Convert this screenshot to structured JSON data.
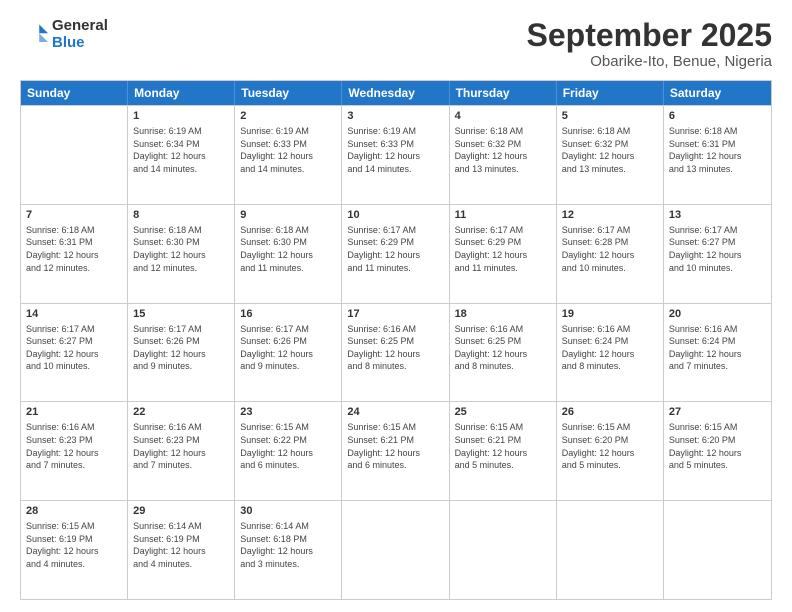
{
  "logo": {
    "general": "General",
    "blue": "Blue"
  },
  "header": {
    "month": "September 2025",
    "location": "Obarike-Ito, Benue, Nigeria"
  },
  "days": [
    "Sunday",
    "Monday",
    "Tuesday",
    "Wednesday",
    "Thursday",
    "Friday",
    "Saturday"
  ],
  "weeks": [
    [
      {
        "day": "",
        "info": ""
      },
      {
        "day": "1",
        "info": "Sunrise: 6:19 AM\nSunset: 6:34 PM\nDaylight: 12 hours\nand 14 minutes."
      },
      {
        "day": "2",
        "info": "Sunrise: 6:19 AM\nSunset: 6:33 PM\nDaylight: 12 hours\nand 14 minutes."
      },
      {
        "day": "3",
        "info": "Sunrise: 6:19 AM\nSunset: 6:33 PM\nDaylight: 12 hours\nand 14 minutes."
      },
      {
        "day": "4",
        "info": "Sunrise: 6:18 AM\nSunset: 6:32 PM\nDaylight: 12 hours\nand 13 minutes."
      },
      {
        "day": "5",
        "info": "Sunrise: 6:18 AM\nSunset: 6:32 PM\nDaylight: 12 hours\nand 13 minutes."
      },
      {
        "day": "6",
        "info": "Sunrise: 6:18 AM\nSunset: 6:31 PM\nDaylight: 12 hours\nand 13 minutes."
      }
    ],
    [
      {
        "day": "7",
        "info": "Sunrise: 6:18 AM\nSunset: 6:31 PM\nDaylight: 12 hours\nand 12 minutes."
      },
      {
        "day": "8",
        "info": "Sunrise: 6:18 AM\nSunset: 6:30 PM\nDaylight: 12 hours\nand 12 minutes."
      },
      {
        "day": "9",
        "info": "Sunrise: 6:18 AM\nSunset: 6:30 PM\nDaylight: 12 hours\nand 11 minutes."
      },
      {
        "day": "10",
        "info": "Sunrise: 6:17 AM\nSunset: 6:29 PM\nDaylight: 12 hours\nand 11 minutes."
      },
      {
        "day": "11",
        "info": "Sunrise: 6:17 AM\nSunset: 6:29 PM\nDaylight: 12 hours\nand 11 minutes."
      },
      {
        "day": "12",
        "info": "Sunrise: 6:17 AM\nSunset: 6:28 PM\nDaylight: 12 hours\nand 10 minutes."
      },
      {
        "day": "13",
        "info": "Sunrise: 6:17 AM\nSunset: 6:27 PM\nDaylight: 12 hours\nand 10 minutes."
      }
    ],
    [
      {
        "day": "14",
        "info": "Sunrise: 6:17 AM\nSunset: 6:27 PM\nDaylight: 12 hours\nand 10 minutes."
      },
      {
        "day": "15",
        "info": "Sunrise: 6:17 AM\nSunset: 6:26 PM\nDaylight: 12 hours\nand 9 minutes."
      },
      {
        "day": "16",
        "info": "Sunrise: 6:17 AM\nSunset: 6:26 PM\nDaylight: 12 hours\nand 9 minutes."
      },
      {
        "day": "17",
        "info": "Sunrise: 6:16 AM\nSunset: 6:25 PM\nDaylight: 12 hours\nand 8 minutes."
      },
      {
        "day": "18",
        "info": "Sunrise: 6:16 AM\nSunset: 6:25 PM\nDaylight: 12 hours\nand 8 minutes."
      },
      {
        "day": "19",
        "info": "Sunrise: 6:16 AM\nSunset: 6:24 PM\nDaylight: 12 hours\nand 8 minutes."
      },
      {
        "day": "20",
        "info": "Sunrise: 6:16 AM\nSunset: 6:24 PM\nDaylight: 12 hours\nand 7 minutes."
      }
    ],
    [
      {
        "day": "21",
        "info": "Sunrise: 6:16 AM\nSunset: 6:23 PM\nDaylight: 12 hours\nand 7 minutes."
      },
      {
        "day": "22",
        "info": "Sunrise: 6:16 AM\nSunset: 6:23 PM\nDaylight: 12 hours\nand 7 minutes."
      },
      {
        "day": "23",
        "info": "Sunrise: 6:15 AM\nSunset: 6:22 PM\nDaylight: 12 hours\nand 6 minutes."
      },
      {
        "day": "24",
        "info": "Sunrise: 6:15 AM\nSunset: 6:21 PM\nDaylight: 12 hours\nand 6 minutes."
      },
      {
        "day": "25",
        "info": "Sunrise: 6:15 AM\nSunset: 6:21 PM\nDaylight: 12 hours\nand 5 minutes."
      },
      {
        "day": "26",
        "info": "Sunrise: 6:15 AM\nSunset: 6:20 PM\nDaylight: 12 hours\nand 5 minutes."
      },
      {
        "day": "27",
        "info": "Sunrise: 6:15 AM\nSunset: 6:20 PM\nDaylight: 12 hours\nand 5 minutes."
      }
    ],
    [
      {
        "day": "28",
        "info": "Sunrise: 6:15 AM\nSunset: 6:19 PM\nDaylight: 12 hours\nand 4 minutes."
      },
      {
        "day": "29",
        "info": "Sunrise: 6:14 AM\nSunset: 6:19 PM\nDaylight: 12 hours\nand 4 minutes."
      },
      {
        "day": "30",
        "info": "Sunrise: 6:14 AM\nSunset: 6:18 PM\nDaylight: 12 hours\nand 3 minutes."
      },
      {
        "day": "",
        "info": ""
      },
      {
        "day": "",
        "info": ""
      },
      {
        "day": "",
        "info": ""
      },
      {
        "day": "",
        "info": ""
      }
    ]
  ]
}
